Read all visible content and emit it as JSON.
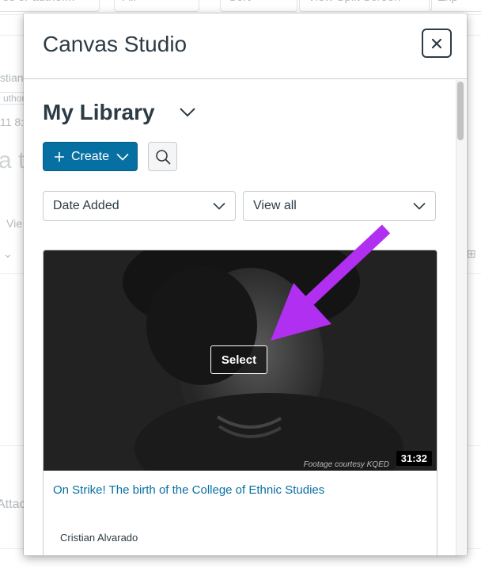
{
  "background": {
    "toolbar": {
      "search_fragment": "es or author...",
      "filter_value": "All",
      "sort_label": "Sort",
      "split_screen_label": "View Split Screen",
      "export_fragment": "Exp"
    },
    "fragments": {
      "author_name": "stian",
      "author_tag": "uthor",
      "date": "11 8:",
      "heading": "a t",
      "view": "Vie",
      "attach": "Attac"
    }
  },
  "modal": {
    "title": "Canvas Studio",
    "close_label": "×",
    "library_title": "My Library",
    "create_label": "Create",
    "sort_select": "Date Added",
    "view_select": "View all",
    "icons": {
      "close": "close-icon",
      "library_menu": "chevron-down-icon",
      "create_plus": "plus-icon",
      "create_menu": "chevron-down-icon",
      "search": "search-icon"
    },
    "media": {
      "select_label": "Select",
      "duration": "31:32",
      "watermark": "Footage courtesy KQED",
      "title": "On Strike! The birth of the College of Ethnic Studies",
      "author": "Cristian Alvarado"
    }
  },
  "colors": {
    "primary": "#0770a3",
    "text": "#2d3b45",
    "annotation_arrow": "#b02ff0"
  }
}
